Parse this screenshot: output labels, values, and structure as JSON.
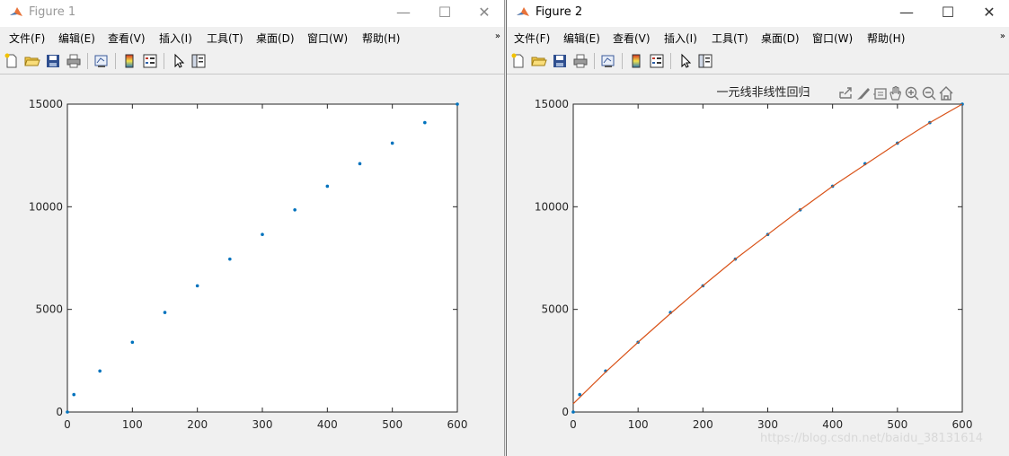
{
  "windows": [
    {
      "title": "Figure 1",
      "active": false,
      "menu": [
        "文件(F)",
        "编辑(E)",
        "查看(V)",
        "插入(I)",
        "工具(T)",
        "桌面(D)",
        "窗口(W)",
        "帮助(H)"
      ],
      "menu_overflow": "»",
      "chart_data": {
        "type": "scatter",
        "title": "",
        "xlim": [
          0,
          600
        ],
        "ylim": [
          0,
          15000
        ],
        "xticks": [
          0,
          100,
          200,
          300,
          400,
          500,
          600
        ],
        "yticks": [
          0,
          5000,
          10000,
          15000
        ],
        "series": [
          {
            "x": [
              0,
              10,
              50,
              100,
              150,
              200,
              250,
              300,
              350,
              400,
              450,
              500,
              550,
              600
            ],
            "y": [
              0,
              850,
              2000,
              3400,
              4850,
              6150,
              7450,
              8650,
              9850,
              11000,
              12100,
              13100,
              14100,
              15000
            ],
            "color": "#0072bd"
          }
        ]
      }
    },
    {
      "title": "Figure 2",
      "active": true,
      "menu": [
        "文件(F)",
        "编辑(E)",
        "查看(V)",
        "插入(I)",
        "工具(T)",
        "桌面(D)",
        "窗口(W)",
        "帮助(H)"
      ],
      "menu_overflow": "»",
      "chart_data": {
        "type": "scatter",
        "title": "一元线非线性回归",
        "xlim": [
          0,
          600
        ],
        "ylim": [
          0,
          15000
        ],
        "xticks": [
          0,
          100,
          200,
          300,
          400,
          500,
          600
        ],
        "yticks": [
          0,
          5000,
          10000,
          15000
        ],
        "series": [
          {
            "x": [
              0,
              10,
              50,
              100,
              150,
              200,
              250,
              300,
              350,
              400,
              450,
              500,
              550,
              600
            ],
            "y": [
              0,
              850,
              2000,
              3400,
              4850,
              6150,
              7450,
              8650,
              9850,
              11000,
              12100,
              13100,
              14100,
              15000
            ],
            "color": "#0072bd",
            "mode": "markers"
          },
          {
            "x": [
              0,
              50,
              100,
              150,
              200,
              250,
              300,
              350,
              400,
              450,
              500,
              550,
              600
            ],
            "y": [
              400,
              1950,
              3400,
              4800,
              6150,
              7450,
              8650,
              9850,
              11000,
              12050,
              13100,
              14100,
              15000
            ],
            "color": "#d95319",
            "mode": "line"
          }
        ]
      },
      "watermark": "https://blog.csdn.net/baidu_38131614"
    }
  ],
  "icons": {
    "title_min": "—",
    "title_max": "☐",
    "title_close": "✕"
  }
}
